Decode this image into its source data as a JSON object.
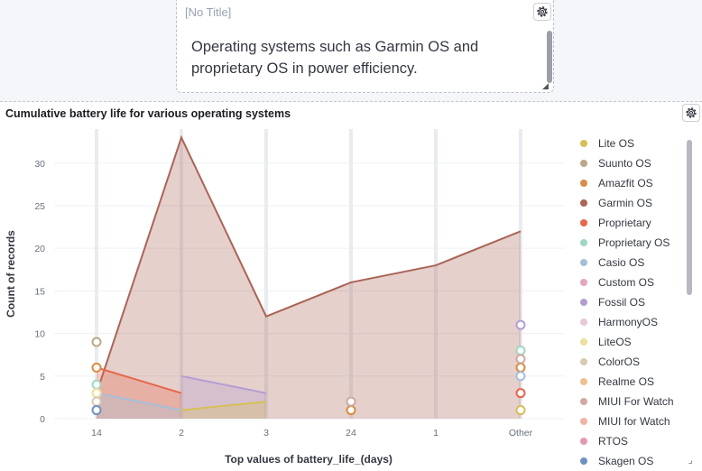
{
  "text_panel": {
    "title": "[No Title]",
    "body": "Operating systems such as Garmin OS and proprietary OS in power efficiency."
  },
  "chart_panel": {
    "title": "Cumulative battery life for various operating systems"
  },
  "chart_data": {
    "type": "area",
    "title": "Cumulative battery life for various operating systems",
    "xlabel": "Top values of battery_life_(days)",
    "ylabel": "Count of records",
    "categories": [
      "14",
      "2",
      "3",
      "24",
      "1",
      "Other"
    ],
    "ylim": [
      0,
      34
    ],
    "yticks": [
      0,
      5,
      10,
      15,
      20,
      25,
      30
    ],
    "grid": true,
    "legend_position": "right",
    "series": [
      {
        "name": "Lite OS",
        "color": "#d6bf57",
        "values": [
          null,
          1,
          2,
          null,
          null,
          1
        ]
      },
      {
        "name": "Suunto OS",
        "color": "#b9a888",
        "values": [
          9,
          null,
          null,
          null,
          null,
          null
        ]
      },
      {
        "name": "Amazfit OS",
        "color": "#da8b45",
        "values": [
          6,
          null,
          null,
          1,
          null,
          6
        ]
      },
      {
        "name": "Garmin OS",
        "color": "#aa6556",
        "values": [
          3,
          33,
          12,
          16,
          18,
          22
        ]
      },
      {
        "name": "Proprietary",
        "color": "#e7664c",
        "values": [
          6,
          3,
          null,
          null,
          null,
          3
        ]
      },
      {
        "name": "Proprietary OS",
        "color": "#9fd7c2",
        "values": [
          4,
          null,
          null,
          null,
          null,
          8
        ]
      },
      {
        "name": "Casio OS",
        "color": "#a6bfd9",
        "values": [
          3,
          1,
          null,
          null,
          null,
          5
        ]
      },
      {
        "name": "Custom OS",
        "color": "#e4a6c0",
        "values": [
          null,
          null,
          null,
          null,
          null,
          null
        ]
      },
      {
        "name": "Fossil OS",
        "color": "#b39dd3",
        "values": [
          null,
          5,
          3,
          null,
          null,
          11
        ]
      },
      {
        "name": "HarmonyOS",
        "color": "#e9c8d9",
        "values": [
          null,
          null,
          null,
          null,
          null,
          null
        ]
      },
      {
        "name": "LiteOS",
        "color": "#eddf9e",
        "values": [
          3,
          null,
          null,
          null,
          null,
          null
        ]
      },
      {
        "name": "ColorOS",
        "color": "#d7cbb4",
        "values": [
          2,
          null,
          null,
          null,
          null,
          null
        ]
      },
      {
        "name": "Realme OS",
        "color": "#eec08f",
        "values": [
          null,
          null,
          null,
          null,
          null,
          null
        ]
      },
      {
        "name": "MIUI For Watch",
        "color": "#ceaaa1",
        "values": [
          null,
          null,
          null,
          2,
          null,
          7
        ]
      },
      {
        "name": "MIUI for Watch",
        "color": "#f0b4a3",
        "values": [
          null,
          null,
          null,
          null,
          null,
          null
        ]
      },
      {
        "name": "RTOS",
        "color": "#e49aae",
        "values": [
          null,
          null,
          null,
          null,
          null,
          null
        ]
      },
      {
        "name": "Skagen OS",
        "color": "#6e92c4",
        "values": [
          1,
          null,
          null,
          null,
          null,
          null
        ]
      }
    ]
  }
}
